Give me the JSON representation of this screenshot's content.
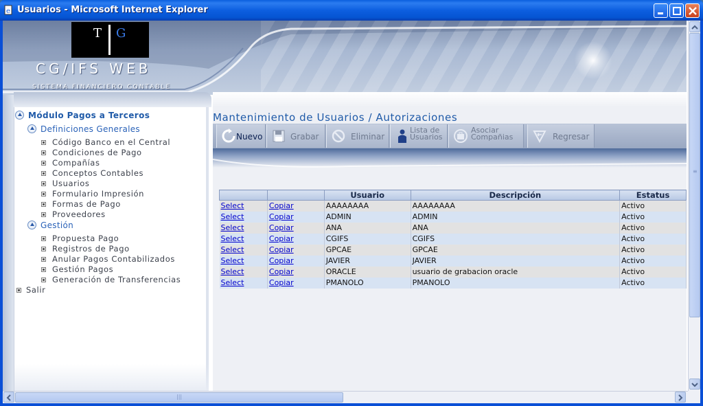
{
  "window": {
    "title": "Usuarios - Microsoft Internet Explorer"
  },
  "banner": {
    "logo_t": "T",
    "logo_g": "G",
    "brand": "CG/IFS  WEB",
    "subtitle": "SISTEMA FINANCIERO CONTABLE"
  },
  "nav": {
    "section_title": "Módulo Pagos a Terceros",
    "group1_title": "Definiciones Generales",
    "group1_items": [
      "Código Banco en el Central",
      "Condiciones de Pago",
      "Compañías",
      "Conceptos Contables",
      "Usuarios",
      "Formulario Impresión",
      "Formas de Pago",
      "Proveedores"
    ],
    "group2_title": "Gestión",
    "group2_items": [
      "Propuesta Pago",
      "Registros de Pago",
      "Anular Pagos Contabilizados",
      "Gestión Pagos",
      "Generación de Transferencias"
    ],
    "exit": "Salir"
  },
  "main": {
    "title": "Mantenimiento de Usuarios / Autorizaciones",
    "toolbar": {
      "nuevo": "Nuevo",
      "grabar": "Grabar",
      "eliminar": "Eliminar",
      "lista_usuarios": "Lista de\nUsuarios",
      "asociar_companias": "Asociar\nCompañias",
      "regresar": "Regresar"
    },
    "table": {
      "headers": [
        "",
        "",
        "Usuario",
        "Descripción",
        "Estatus"
      ],
      "select_label": "Select",
      "copy_label": "Copiar",
      "rows": [
        {
          "usuario": "AAAAAAAA",
          "descripcion": "AAAAAAAA",
          "estatus": "Activo"
        },
        {
          "usuario": "ADMIN",
          "descripcion": "ADMIN",
          "estatus": "Activo"
        },
        {
          "usuario": "ANA",
          "descripcion": "ANA",
          "estatus": "Activo"
        },
        {
          "usuario": "CGIFS",
          "descripcion": "CGIFS",
          "estatus": "Activo"
        },
        {
          "usuario": "GPCAE",
          "descripcion": "GPCAE",
          "estatus": "Activo"
        },
        {
          "usuario": "JAVIER",
          "descripcion": "JAVIER",
          "estatus": "Activo"
        },
        {
          "usuario": "ORACLE",
          "descripcion": "usuario de grabacion oracle",
          "estatus": "Activo"
        },
        {
          "usuario": "PMANOLO",
          "descripcion": "PMANOLO",
          "estatus": "Activo"
        }
      ]
    }
  },
  "colors": {
    "accent": "#1f5aa8",
    "link": "#0000cc",
    "titlebar": "#0554d2"
  }
}
